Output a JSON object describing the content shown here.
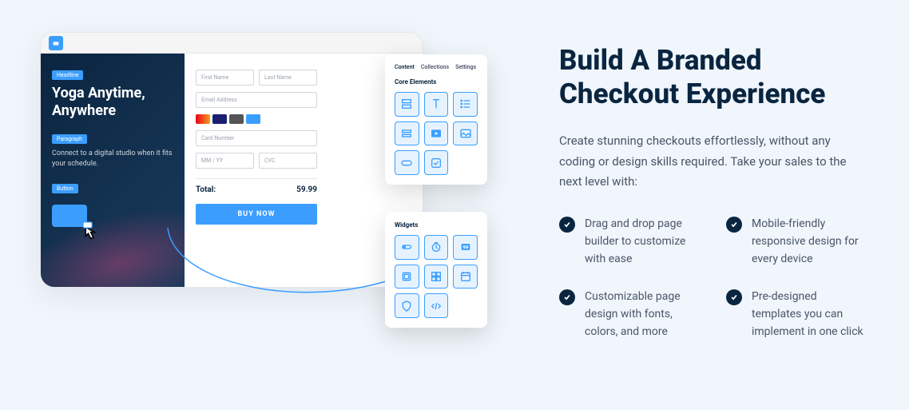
{
  "heading": "Build A Branded Checkout Experience",
  "description": "Create stunning checkouts effortlessly, without any coding or design skills required. Take your sales to the next level with:",
  "features": [
    "Drag and drop page builder to customize with ease",
    "Mobile-friendly responsive design for every device",
    "Customizable page design with fonts, colors, and more",
    "Pre-designed templates you can implement in one click"
  ],
  "mockup": {
    "hero": {
      "headline_tag": "Headline",
      "title": "Yoga Anytime, Anywhere",
      "paragraph_tag": "Paragraph",
      "subtitle": "Connect to a digital studio when it fits your schedule.",
      "button_tag": "Button"
    },
    "form": {
      "first_name": "First Name",
      "last_name": "Last Name",
      "email": "Email Address",
      "card_number": "Card Number",
      "expiry": "MM / YY",
      "cvc": "CVC",
      "total_label": "Total:",
      "total_value": "59.99",
      "buy_button": "BUY NOW"
    },
    "tabs": {
      "content": "Content",
      "collections": "Collections",
      "settings": "Settings"
    },
    "core_elements_label": "Core Elements",
    "widgets_label": "Widgets"
  }
}
